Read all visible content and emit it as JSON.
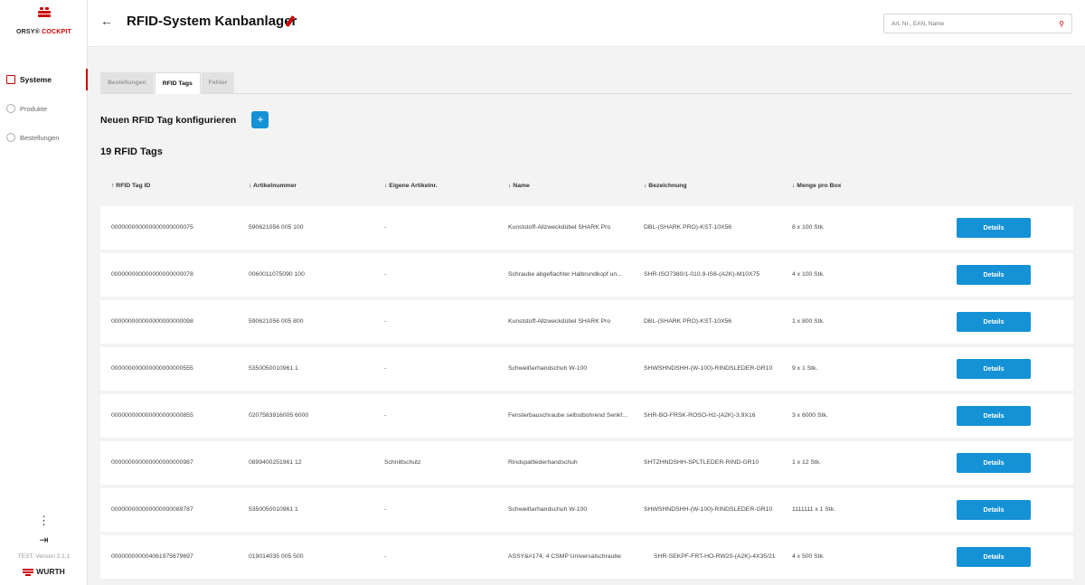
{
  "logo": {
    "brand_a": "ORSY®",
    "brand_b": " COCKPIT"
  },
  "sidebar": {
    "items": [
      {
        "label": "Systeme",
        "icon": "box-icon",
        "active": true
      },
      {
        "label": "Produkte",
        "icon": "tools-icon",
        "active": false
      },
      {
        "label": "Bestellungen",
        "icon": "cart-icon",
        "active": false
      }
    ],
    "version": "TEST: Version 2.1.1",
    "wurth": "WURTH"
  },
  "header": {
    "title": "RFID-System Kanbanlager",
    "search_placeholder": "Art. Nr., EAN, Name"
  },
  "tabs": [
    {
      "label": "Bestellungen",
      "active": false
    },
    {
      "label": "RFID Tags",
      "active": true
    },
    {
      "label": "Fehler",
      "active": false
    }
  ],
  "config": {
    "label": "Neuen RFID Tag konfigurieren",
    "add_symbol": "+"
  },
  "count_label": "19 RFID Tags",
  "table": {
    "headers": [
      "↑ RFID Tag ID",
      "↓ Artikelnummer",
      "↓ Eigene Artikelnr.",
      "↓ Name",
      "↓ Bezeichnung",
      "↓ Menge pro Box"
    ],
    "details_label": "Details",
    "rows": [
      [
        "000000000000000000000075",
        "590621056 005  100",
        "-",
        "Kunststoff-Allzweckdübel SHARK Pro",
        "DBL-(SHARK PRO)-KST-10X56",
        "8 x 100 Stk."
      ],
      [
        "000000000000000000000078",
        "0060011075090  100",
        "-",
        "Schraube abgeflachter Halbrundkopf un...",
        "SHR-ISO7380/1-010.9-IS6-(A2K)-M10X75",
        "4 x 100 Stk."
      ],
      [
        "000000000000000000000098",
        "590621056 005  800",
        "-",
        "Kunststoff-Allzweckdübel SHARK Pro",
        "DBL-(SHARK PRO)-KST-10X56",
        "1 x 800 Stk."
      ],
      [
        "000000000000000000000555",
        "5350050010961    1",
        "-",
        "Schweißerhandschuh W-100",
        "SHWSHNDSHH-(W-100)-RINDSLEDER-GR10",
        "9 x 1 Stk."
      ],
      [
        "000000000000000000000855",
        "0207583916005 6000",
        "-",
        "Fensterbauschraube selbstbohrend Senkf...",
        "SHR-BO-FRSK-ROSO-H2-(A2K)-3,9X16",
        "3 x 6000 Stk."
      ],
      [
        "000000000000000000000987",
        "0899400251961    12",
        "Schnittschutz",
        "Rindspaltlederhandschuh",
        "SHTZHNDSHH-SPLTLEDER-RIND-GR10",
        "1 x 12 Stk."
      ],
      [
        "000000000000000000089787",
        "5350050010961    1",
        "-",
        "Schweißerhandschuh W-100",
        "SHWSHNDSHH-(W-100)-RINDSLEDER-GR10",
        "1111111 x 1 Stk."
      ],
      [
        "000000000004061975679697",
        "019014035 005  500",
        "-",
        "ASSY&#174; 4 CSMP Universalschraube",
        "SHR-SEKPF-FRT-HO-RW20-(A2K)-4X35/21",
        "4 x 500 Stk."
      ]
    ]
  }
}
